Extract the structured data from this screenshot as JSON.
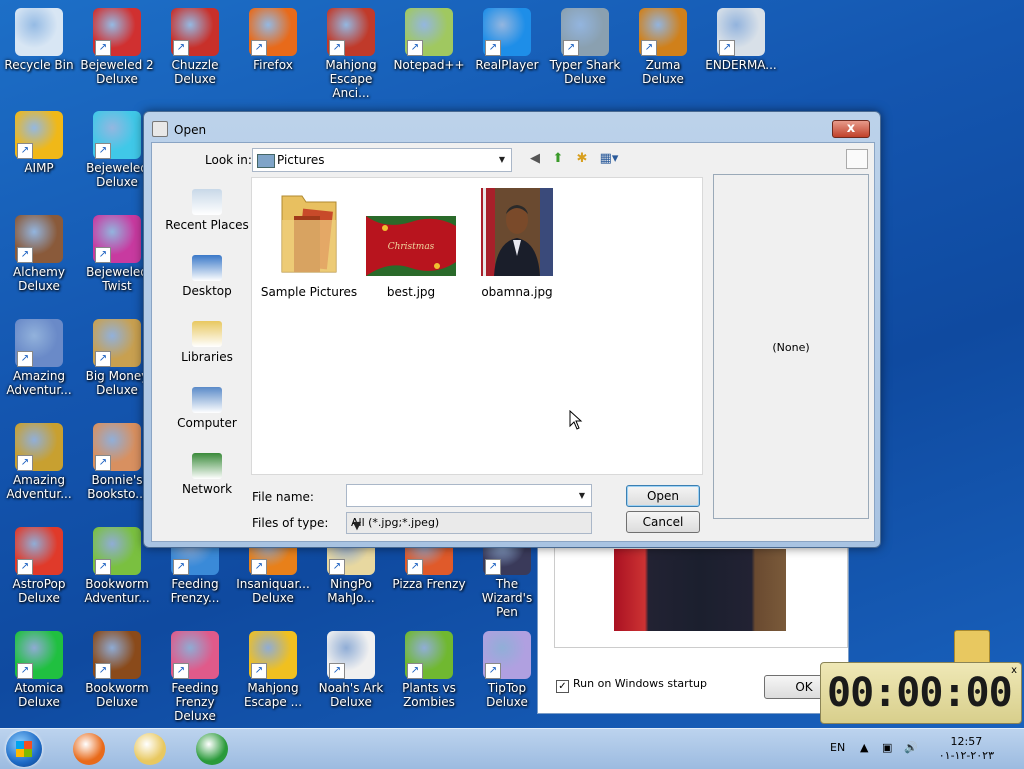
{
  "desktop_icons": [
    {
      "label": "Recycle Bin",
      "icon": "recycle-bin-icon",
      "color": "#d8e6f4"
    },
    {
      "label": "Bejeweled 2 Deluxe",
      "icon": "bejeweled-2-icon",
      "color": "#d03030"
    },
    {
      "label": "Chuzzle Deluxe",
      "icon": "chuzzle-icon",
      "color": "#c8302a"
    },
    {
      "label": "Firefox",
      "icon": "firefox-icon",
      "color": "#e86a1a"
    },
    {
      "label": "Mahjong Escape Anci...",
      "icon": "mahjong-temple-icon",
      "color": "#c03a2a"
    },
    {
      "label": "Notepad++",
      "icon": "notepad-plus-icon",
      "color": "#a0c860"
    },
    {
      "label": "RealPlayer",
      "icon": "realplayer-icon",
      "color": "#1e8ee8"
    },
    {
      "label": "Typer Shark Deluxe",
      "icon": "typer-shark-icon",
      "color": "#8aa0b0"
    },
    {
      "label": "Zuma Deluxe",
      "icon": "zuma-icon",
      "color": "#d0801a"
    },
    {
      "label": "ENDERMA...",
      "icon": "endermanch-icon",
      "color": "#d8e0e8"
    },
    {
      "label": "AIMP",
      "icon": "aimp-icon",
      "color": "#f0b818"
    },
    {
      "label": "Bejeweled Deluxe",
      "icon": "bejeweled-icon",
      "color": "#40c8e8"
    },
    {
      "label": "Alchemy Deluxe",
      "icon": "alchemy-icon",
      "color": "#8a5a3a"
    },
    {
      "label": "Bejeweled Twist",
      "icon": "bejeweled-twist-icon",
      "color": "#c83aa0"
    },
    {
      "label": "Amazing Adventur...",
      "icon": "amazing-adventures-icon",
      "color": "#6a8ac8"
    },
    {
      "label": "Big Money Deluxe",
      "icon": "big-money-icon",
      "color": "#c8a050"
    },
    {
      "label": "Amazing Adventur...",
      "icon": "amazing-adventures-2-icon",
      "color": "#c8a030"
    },
    {
      "label": "Bonnie's Booksto...",
      "icon": "bonnies-bookstore-icon",
      "color": "#d89060"
    },
    {
      "label": "AstroPop Deluxe",
      "icon": "astropop-icon",
      "color": "#e03a2a"
    },
    {
      "label": "Bookworm Adventur...",
      "icon": "bookworm-adventures-icon",
      "color": "#7ac040"
    },
    {
      "label": "Feeding Frenzy...",
      "icon": "feeding-frenzy-2-icon",
      "color": "#3a8ad8"
    },
    {
      "label": "Insaniquar... Deluxe",
      "icon": "insaniquarium-icon",
      "color": "#e8801a"
    },
    {
      "label": "NingPo MahJo...",
      "icon": "ningpo-mahjong-icon",
      "color": "#e8d8a0"
    },
    {
      "label": "Pizza Frenzy",
      "icon": "pizza-frenzy-icon",
      "color": "#e05a2a"
    },
    {
      "label": "The Wizard's Pen",
      "icon": "wizards-pen-icon",
      "color": "#3a3a5a"
    },
    {
      "label": "Atomica Deluxe",
      "icon": "atomica-icon",
      "color": "#20c040"
    },
    {
      "label": "Bookworm Deluxe",
      "icon": "bookworm-icon",
      "color": "#8a4a1a"
    },
    {
      "label": "Feeding Frenzy Deluxe",
      "icon": "feeding-frenzy-icon",
      "color": "#e05a8a"
    },
    {
      "label": "Mahjong Escape ...",
      "icon": "mahjong-escape-icon",
      "color": "#f0c020"
    },
    {
      "label": "Noah's Ark Deluxe",
      "icon": "noahs-ark-icon",
      "color": "#f0f0f0"
    },
    {
      "label": "Plants vs Zombies",
      "icon": "plants-vs-zombies-icon",
      "color": "#70b830"
    },
    {
      "label": "TipTop Deluxe",
      "icon": "tiptop-icon",
      "color": "#b0a0e0"
    }
  ],
  "dialog": {
    "title": "Open",
    "close_label": "x",
    "look_in_label": "Look in:",
    "look_in_value": "Pictures",
    "places": [
      {
        "label": "Recent Places",
        "icon": "recent-places-icon",
        "color": "#c8d8e8"
      },
      {
        "label": "Desktop",
        "icon": "desktop-icon",
        "color": "#3a78c8"
      },
      {
        "label": "Libraries",
        "icon": "libraries-icon",
        "color": "#e8c860"
      },
      {
        "label": "Computer",
        "icon": "computer-icon",
        "color": "#5a8ac8"
      },
      {
        "label": "Network",
        "icon": "network-icon",
        "color": "#3a8a3a"
      }
    ],
    "files": [
      {
        "label": "Sample Pictures",
        "icon": "folder-icon"
      },
      {
        "label": "best.jpg",
        "icon": "christmas-image-thumb"
      },
      {
        "label": "obamna.jpg",
        "icon": "portrait-image-thumb"
      }
    ],
    "preview_text": "(None)",
    "file_name_label": "File name:",
    "file_name_value": "",
    "files_of_type_label": "Files of type:",
    "files_of_type_value": "All (*.jpg;*.jpeg)",
    "open_label": "Open",
    "cancel_label": "Cancel"
  },
  "bg_window": {
    "checkbox_label": "Run on Windows startup",
    "checkbox_mark": "✓",
    "ok_label": "OK"
  },
  "timer": {
    "display": "00:00:00",
    "close": "x"
  },
  "taskbar": {
    "language": "EN",
    "time": "12:57",
    "date": "٢٠٢٣-١٢-٠١",
    "apps": [
      {
        "icon": "firefox-taskbar-icon",
        "color": "#e86a1a"
      },
      {
        "icon": "file-explorer-taskbar-icon",
        "color": "#e8c860"
      },
      {
        "icon": "chrome-taskbar-icon",
        "color": "#2a9a3a"
      }
    ]
  }
}
